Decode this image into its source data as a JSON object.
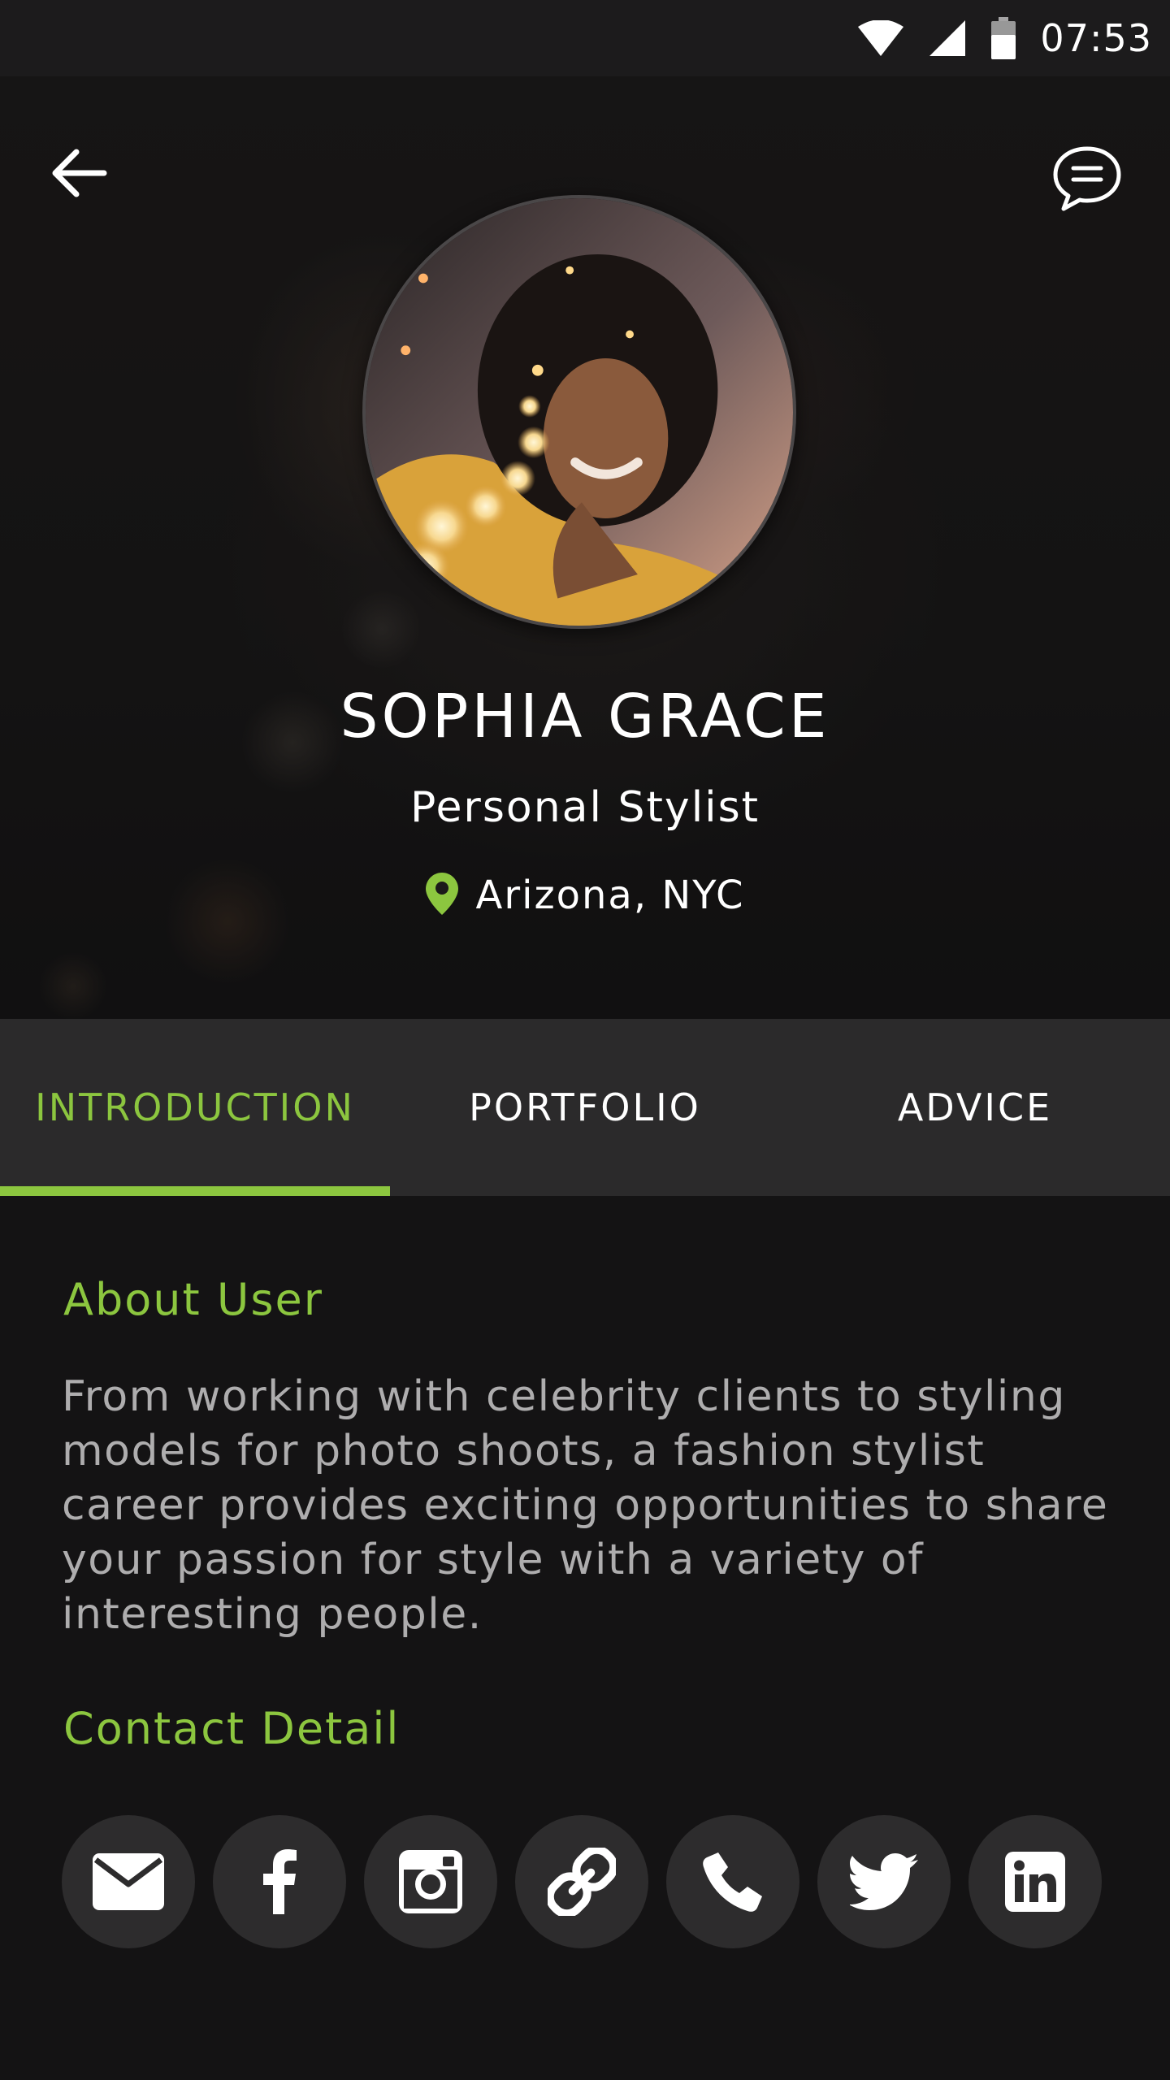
{
  "status_bar": {
    "time": "07:53",
    "icons": [
      "wifi-icon",
      "cellular-signal-icon",
      "battery-icon"
    ]
  },
  "header": {
    "back_icon": "arrow-left-icon",
    "chat_icon": "chat-bubble-icon"
  },
  "profile": {
    "name": "SOPHIA GRACE",
    "role": "Personal Stylist",
    "location": "Arizona, NYC",
    "location_icon": "map-pin-icon"
  },
  "tabs": [
    {
      "label": "INTRODUCTION",
      "active": true
    },
    {
      "label": "PORTFOLIO",
      "active": false
    },
    {
      "label": "ADVICE",
      "active": false
    }
  ],
  "about": {
    "heading": "About User",
    "text": "From working with celebrity clients to styling models for photo shoots, a fashion stylist career provides exciting opportunities to share your passion for style with a variety of interesting people."
  },
  "contact": {
    "heading": "Contact Detail",
    "buttons": [
      "email-icon",
      "facebook-icon",
      "instagram-icon",
      "link-icon",
      "phone-icon",
      "twitter-icon",
      "linkedin-icon"
    ]
  },
  "colors": {
    "accent": "#8cc63f",
    "background": "#141314",
    "tab_bar": "#2b2a2b",
    "social_button": "#2d2c2d",
    "body_text": "#aeadae"
  }
}
